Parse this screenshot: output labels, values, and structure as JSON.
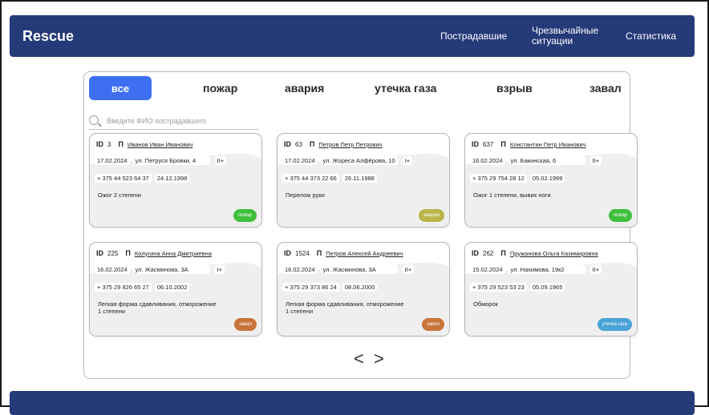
{
  "brand": "Rescue",
  "nav": [
    "Пострадавшие",
    "Чрезвычайные ситуации",
    "Статистика"
  ],
  "tabs": [
    "все",
    "пожар",
    "авария",
    "утечка газа",
    "взрыв",
    "завал"
  ],
  "search": {
    "placeholder": "Введите ФИО пострадавшего"
  },
  "id_label": "ID",
  "p_label": "П",
  "pager": {
    "prev": "<",
    "next": ">"
  },
  "cards": [
    {
      "id": "3",
      "name": "Иванов Иван Иванович",
      "date": "17.02.2024",
      "address": "ул. Петруся Бровки, 4",
      "blood": "II+",
      "phone": "+ 375 44 523 64 37",
      "birth": "24.12.1998",
      "diagnosis": "Ожог 2 степени",
      "badge": "пожар",
      "badge_color": "#3fbf3a"
    },
    {
      "id": "63",
      "name": "Петров Петр Петрович",
      "date": "17.02.2024",
      "address": "ул. Жореса Алфёрова, 10",
      "blood": "I+",
      "phone": "+ 375 44 373 22 66",
      "birth": "26.11.1988",
      "diagnosis": "Перелом руки",
      "badge": "авария",
      "badge_color": "#b9b54a"
    },
    {
      "id": "637",
      "name": "Константин Петр Иванович",
      "date": "16.02.2024",
      "address": "ул. Бакинская, 6",
      "blood": "II+",
      "phone": "+ 375 29 754 28 12",
      "birth": "05.02.1999",
      "diagnosis": "Ожог 1 степени, вывих ноги",
      "badge": "пожар",
      "badge_color": "#3fbf3a"
    },
    {
      "id": "225",
      "name": "Колугина Анна Дмитриевна",
      "date": "16.02.2024",
      "address": "ул. Жасминова, 3А",
      "blood": "I+",
      "phone": "+ 375 29 826 65 27",
      "birth": "06.10.2002",
      "diagnosis": "Легкая форма сдавливания, отморожение 1 степени",
      "badge": "завал",
      "badge_color": "#c9743a"
    },
    {
      "id": "1524",
      "name": "Петров Алексей Андреевич",
      "date": "16.02.2024",
      "address": "ул. Жасминова, 3А",
      "blood": "II+",
      "phone": "+ 375 29 373 86 24",
      "birth": "08.06.2000",
      "diagnosis": "Легкая форма сдавливания, отморожение 1 степени",
      "badge": "завал",
      "badge_color": "#c9743a"
    },
    {
      "id": "262",
      "name": "Пружанова Ольга Казимировна",
      "date": "15.02.2024",
      "address": "ул. Нахимова, 19к2",
      "blood": "II+",
      "phone": "+ 375 29 523 53 23",
      "birth": "05.09.1965",
      "diagnosis": "Обморок",
      "badge": "утечка газа",
      "badge_color": "#4aa3d6"
    }
  ]
}
